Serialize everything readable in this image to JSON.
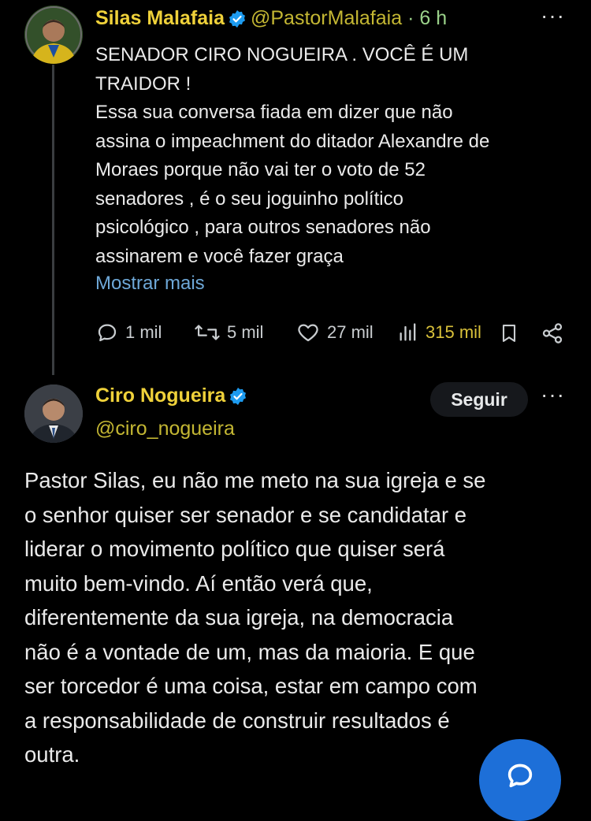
{
  "tweet1": {
    "author_name": "Silas Malafaia",
    "handle": "@PastorMalafaia",
    "separator": "·",
    "time": "6 h",
    "more_label": "···",
    "text": "SENADOR CIRO NOGUEIRA . VOCÊ É UM\nTRAIDOR !\nEssa sua conversa fiada em dizer que não\nassina o impeachment do ditador Alexandre de\nMoraes porque não vai ter o voto de 52\nsenadores , é o seu joguinho político\npsicológico , para outros senadores não\nassinarem e você fazer graça",
    "show_more": "Mostrar mais",
    "replies": "1 mil",
    "reposts": "5 mil",
    "likes": "27 mil",
    "views": "315 mil"
  },
  "tweet2": {
    "author_name": "Ciro Nogueira",
    "handle": "@ciro_nogueira",
    "follow_label": "Seguir",
    "more_label": "···",
    "text": "Pastor Silas, eu não me meto na sua igreja e se\no senhor quiser ser senador e se candidatar e\nliderar o movimento político que quiser será\nmuito bem-vindo. Aí então verá que,\ndiferentemente da sua igreja, na democracia\nnão é a vontade de um, mas da maioria. E que\nser torcedor é uma coisa, estar em campo com\na responsabilidade de construir resultados é\noutra."
  },
  "icons": {
    "verified": "verified-badge-icon",
    "reply": "reply-icon",
    "repost": "repost-icon",
    "like": "heart-icon",
    "views": "views-icon",
    "bookmark": "bookmark-icon",
    "share": "share-icon",
    "compose": "compose-icon"
  },
  "colors": {
    "background": "#000000",
    "name": "#efd13a",
    "verified": "#1d9bf0",
    "link": "#6ea8d8",
    "fab": "#1d6fd8"
  }
}
